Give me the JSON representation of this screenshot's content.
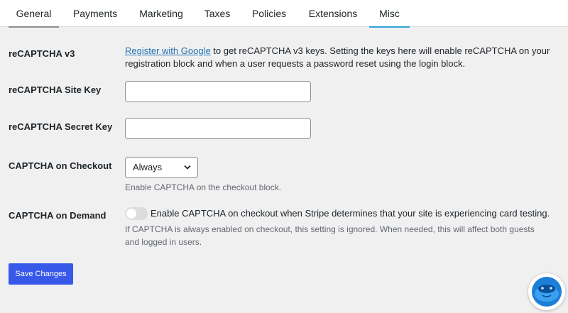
{
  "tabs": [
    {
      "label": "General"
    },
    {
      "label": "Payments"
    },
    {
      "label": "Marketing"
    },
    {
      "label": "Taxes"
    },
    {
      "label": "Policies"
    },
    {
      "label": "Extensions"
    },
    {
      "label": "Misc"
    }
  ],
  "active_tab": "Misc",
  "settings": {
    "recaptcha_v3": {
      "label": "reCAPTCHA v3",
      "link_text": "Register with Google",
      "description": " to get reCAPTCHA v3 keys. Setting the keys here will enable reCAPTCHA on your registration block and when a user requests a password reset using the login block."
    },
    "site_key": {
      "label": "reCAPTCHA Site Key",
      "value": ""
    },
    "secret_key": {
      "label": "reCAPTCHA Secret Key",
      "value": ""
    },
    "captcha_checkout": {
      "label": "CAPTCHA on Checkout",
      "selected": "Always",
      "help": "Enable CAPTCHA on the checkout block."
    },
    "captcha_demand": {
      "label": "CAPTCHA on Demand",
      "enabled": false,
      "toggle_text": "Enable CAPTCHA on checkout when Stripe determines that your site is experiencing card testing.",
      "help": "If CAPTCHA is always enabled on checkout, this setting is ignored. When needed, this will affect both guests and logged in users."
    }
  },
  "save_button": "Save Changes",
  "colors": {
    "accent_tab": "#2da4d8",
    "primary_button": "#3858e9",
    "link": "#2271b1",
    "background": "#f0f0f1"
  },
  "icons": {
    "select_chevron": "chevron-down-icon",
    "help_widget": "help-chat-icon"
  }
}
